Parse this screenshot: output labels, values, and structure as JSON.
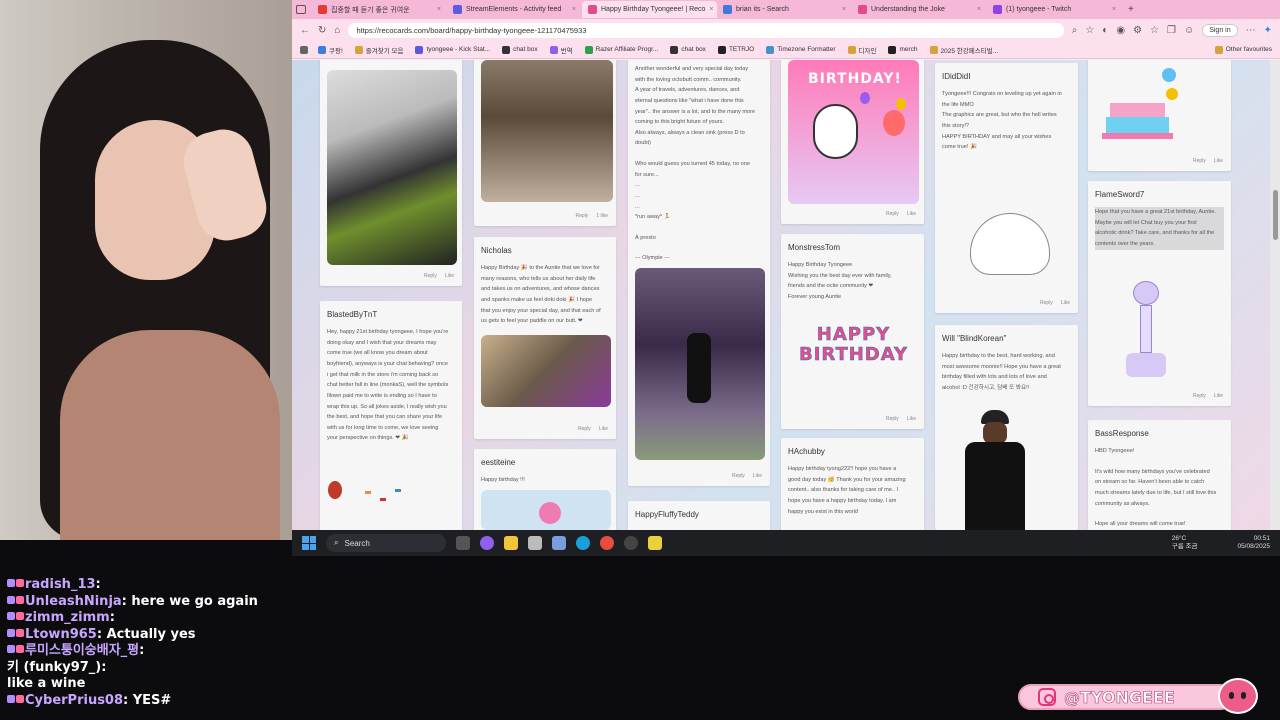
{
  "browser": {
    "tabs": [
      {
        "label": "집중할 때 듣기 좋은 귀여운",
        "color": "#e53935",
        "active": false
      },
      {
        "label": "StreamElements - Activity feed",
        "color": "#5c5ce0",
        "active": false
      },
      {
        "label": "Happy Birthday Tyongeee! | Reco",
        "color": "#e24a8a",
        "active": true
      },
      {
        "label": "brian its - Search",
        "color": "#3f7ad6",
        "active": false
      },
      {
        "label": "Understanding the Joke",
        "color": "#e24a8a",
        "active": false
      },
      {
        "label": "(1) tyongeee - Twitch",
        "color": "#8e44e6",
        "active": false
      }
    ],
    "url": "https://recocards.com/board/happy-birthday-tyongeee-121170475933",
    "signin_label": "Sign in",
    "bookmarks": [
      "쿠팡!",
      "즐겨찾기 모음",
      "tyongeee - Kick Stat...",
      "chat box",
      "번역",
      "Razer Affiliate Progr...",
      "chat box",
      "TETRJO",
      "Timezone Formatter",
      "디자인",
      "merch",
      "2025 한강페스티벌..."
    ],
    "bookmarks_other": "Other favourites"
  },
  "cards": {
    "reply": "Reply",
    "like": "Like",
    "like_count_1": "1 like",
    "olympie_text": [
      "Another wonderful and very special day today",
      "with the loving octobutt comm.. community.",
      "A year of travels, adventures, dances, and",
      "eternal questions like \"what i have done this",
      "year\".. the answer is a lot, and to the many more",
      "coming to this bright future of yours.",
      "Also always, always a clean sink (press D to",
      "doubt)",
      "",
      "Who would guess you turned 45 today, no one",
      "for sure...",
      "...",
      "...",
      "...",
      "*run away* 🏃",
      "",
      "À presto",
      "",
      "--- Olympie ---"
    ],
    "birthday_banner": "BIRTHDAY!",
    "ididdidi": {
      "name": "IDidDidI",
      "text": [
        "Tyongeee!!! Congrats on leveling up yet again in",
        "the life MMO",
        "The graphics are great, but who the hell writes",
        "this story!?",
        "HAPPY BIRTHDAY and may all your wishes",
        "come true! 🎉"
      ]
    },
    "flamesword": {
      "name": "FlameSword7",
      "text": [
        "Hope that you have a great 21st birthday, Auntie.",
        "Maybe you will let Chat buy you your first",
        "alcoholic drink? Take care, and thanks for all the",
        "contents over the years."
      ]
    },
    "nicholas": {
      "name": "Nicholas",
      "text": [
        "Happy Birthday 🎉 to the Auntie that we love for",
        "many reasons, who tells us about her daily life",
        "and takes us on adventures, and whose dances",
        "and spanks make us feel doki doki 🎉 I hope",
        "that you enjoy your special day, and that each of",
        "us gets to feel your paddle on our butt. ❤"
      ]
    },
    "blasted": {
      "name": "BlastedByTnT",
      "text": [
        "Hey, happy 21st birthday tyongeee, I hope you're",
        "doing okay and I wish that your dreams may",
        "come true (we all know you dream about",
        "boyfriend), anyways is your chat behaving? once",
        "i get that milk in the store i'm coming back so",
        "chat better fall in line (monkaS), well the symbols",
        "Illown paid me to write is ending so I have to",
        "wrap this up. So all jokes aside, I really wish you",
        "the best, and hope that you can share your life",
        "with us for long time to come, we love seeing",
        "your perspective on things. ❤ 🎉"
      ]
    },
    "monstress": {
      "name": "MonstressTom",
      "text": [
        "Happy Birthday Tyongeee",
        "Wishing you the best day ever with family,",
        "friends and the octie community ❤",
        "Forever young Auntie"
      ]
    },
    "happy_birthday_img": "HAPPY BIRTHDAY",
    "will": {
      "name": "Will \"BlindKorean\"",
      "text": [
        "Happy birthday to the best, hard working, and",
        "most awesome moonie!! Hope you have a great",
        "birthday filled with lots and lots of love and",
        "alcohol :D 건강하시고, 담배 또 봐요!!"
      ]
    },
    "hachubby": {
      "name": "HAchubby",
      "text": [
        "Happy birthday tyong222!! hope you have a",
        "good day today 🥳 Thank you for your amazing",
        "content.. also thanks for taking care of me.. I",
        "hope you have a happy birthday today. I am",
        "happy you exist in this world"
      ]
    },
    "bass": {
      "name": "BassResponse",
      "text": [
        "HBD Tyongeee!",
        "",
        "It's wild how many birthdays you've celebrated",
        "on stream so far. Haven't been able to catch",
        "much streams lately due to life, but I still love this",
        "community as always.",
        "",
        "Hope all your dreams will come true!"
      ]
    },
    "eestiteine": {
      "name": "eestiteine",
      "text": [
        "Happy birthday !!!"
      ]
    },
    "happyfluffy": {
      "name": "HappyFluffyTeddy"
    }
  },
  "taskbar": {
    "search": "Search",
    "weather_temp": "26°C",
    "weather_desc": "구름 조금",
    "time": "00:51",
    "date": "05/08/2025"
  },
  "chat": [
    {
      "user": "radish_13",
      "text": "",
      "color": "#c8a6ff"
    },
    {
      "user": "UnleashNinja",
      "text": "here we go again",
      "color": "#c8a6ff"
    },
    {
      "user": "zimm_zimm",
      "text": "",
      "color": "#c8a6ff"
    },
    {
      "user": "Ltown965",
      "text": "Actually yes",
      "color": "#c8a6ff"
    },
    {
      "user": "루미스퉁이숭배자_평",
      "text": "",
      "color": "#c8a6ff"
    },
    {
      "user": "키 (funky97_)",
      "text": "",
      "color": "#ffffff"
    },
    {
      "user": "",
      "text": "like a wine",
      "color": "#ffffff"
    },
    {
      "user": "CyberPrius08",
      "text": "YES#",
      "color": "#c8a6ff"
    }
  ],
  "social": {
    "handle": "@TYONGEEE"
  }
}
